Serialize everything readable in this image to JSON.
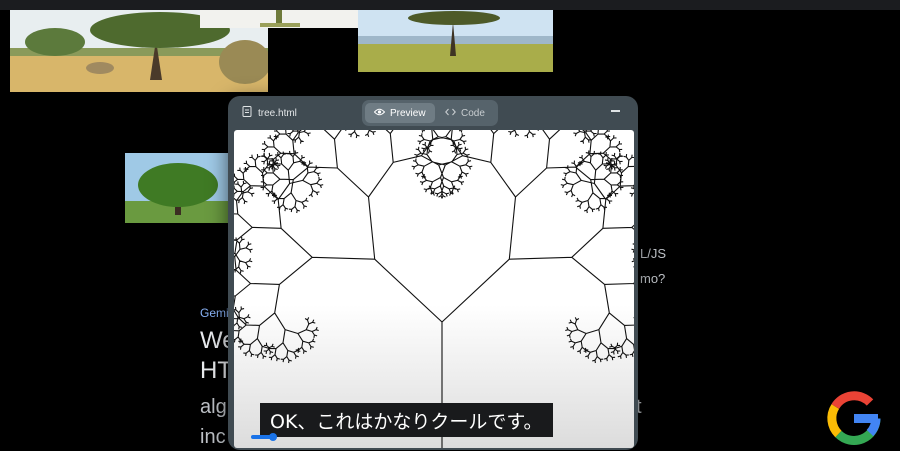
{
  "window": {
    "file_name": "tree.html",
    "tabs": [
      {
        "label": "Preview",
        "active": true
      },
      {
        "label": "Code",
        "active": false
      }
    ]
  },
  "background": {
    "gemini_label": "Gemi",
    "heading_lines": [
      "We",
      "HT"
    ],
    "body_lines": [
      "alg",
      "inc"
    ],
    "side_fragments": [
      "L/JS",
      "mo?",
      "t"
    ]
  },
  "caption": "OK、これはかなりクールです。",
  "icons": [
    "file-icon",
    "eye-icon",
    "code-icon",
    "minimize-icon",
    "google-logo"
  ],
  "colors": {
    "page_background": "#000000",
    "window_frame": "#404b52",
    "tab_active": "#6f7c84",
    "gemini_accent": "#8ab4f8",
    "caption_background": "#191a1c",
    "fractal_stroke": "#111111"
  }
}
